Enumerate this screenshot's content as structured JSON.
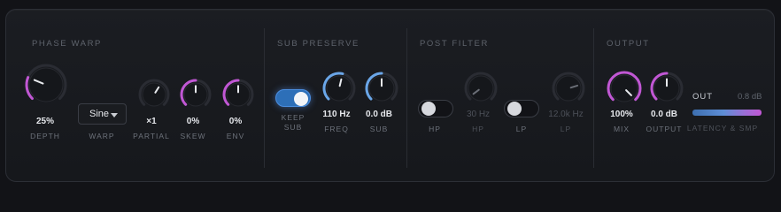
{
  "sections": {
    "phase_warp": "PHASE WARP",
    "sub_preserve": "SUB PRESERVE",
    "post_filter": "POST FILTER",
    "output": "OUTPUT"
  },
  "phase_warp": {
    "depth": {
      "value": "25%",
      "label": "DEPTH",
      "level": 0.25
    },
    "warp": {
      "selected": "Sine",
      "label": "WARP"
    },
    "partial": {
      "value": "×1",
      "label": "PARTIAL",
      "level": 0.62
    },
    "skew": {
      "value": "0%",
      "label": "SKEW",
      "level": 0.5
    },
    "env": {
      "value": "0%",
      "label": "ENV",
      "level": 0.5
    }
  },
  "sub_preserve": {
    "keep_sub": {
      "label_line1": "KEEP",
      "label_line2": "SUB",
      "on": true
    },
    "freq": {
      "value": "110 Hz",
      "label": "FREQ",
      "level": 0.55
    },
    "sub": {
      "value": "0.0 dB",
      "label": "SUB",
      "level": 0.5
    }
  },
  "post_filter": {
    "hp_toggle": {
      "label": "HP",
      "on": false
    },
    "hp_freq": {
      "value": "30 Hz",
      "label": "HP",
      "level": 0.03
    },
    "lp_toggle": {
      "label": "LP",
      "on": false
    },
    "lp_freq": {
      "value": "12.0k Hz",
      "label": "LP",
      "level": 0.77
    }
  },
  "output": {
    "mix": {
      "value": "100%",
      "label": "MIX",
      "level": 1.0
    },
    "output_gain": {
      "value": "0.0 dB",
      "label": "OUTPUT",
      "level": 0.5
    },
    "meter": {
      "label": "OUT",
      "db": "0.8 dB",
      "subtitle": "LATENCY & SMP",
      "level": 1.0
    }
  },
  "colors": {
    "purple": "#c157d4",
    "blue": "#6aa6e8",
    "track": "#2a2c33",
    "knob_face": "#15171b",
    "indicator": "#e8eaee",
    "dim_indicator": "#6a6e76"
  }
}
